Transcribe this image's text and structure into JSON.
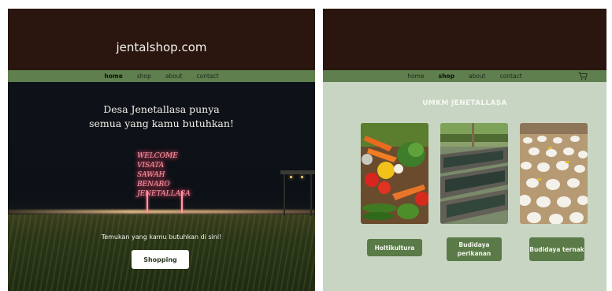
{
  "left_page": {
    "site_title": "jentalshop.com",
    "nav": [
      {
        "label": "home",
        "active": true
      },
      {
        "label": "shop",
        "active": false
      },
      {
        "label": "about",
        "active": false
      },
      {
        "label": "contact",
        "active": false
      }
    ],
    "hero": {
      "heading_line1": "Desa Jenetallasa punya",
      "heading_line2": "semua yang kamu butuhkan!",
      "neon_sign": [
        "WELCOME VISATA",
        "SAWAH BENARO",
        "JENETALLASA"
      ],
      "cta_text": "Temukan yang kamu butuhkan di sini!",
      "cta_button": "Shopping"
    }
  },
  "right_page": {
    "nav": [
      {
        "label": "home",
        "active": false
      },
      {
        "label": "shop",
        "active": true
      },
      {
        "label": "about",
        "active": false
      },
      {
        "label": "contact",
        "active": false
      }
    ],
    "cart_icon": "shopping-cart-icon",
    "heading": "UMKM JENETALLASA",
    "categories": [
      {
        "label": "Holtikultura",
        "image": "vegetables-photo"
      },
      {
        "label": "Budidaya perikanan",
        "image": "fish-ponds-photo"
      },
      {
        "label": "Budidaya ternak",
        "image": "poultry-farm-photo"
      }
    ]
  },
  "colors": {
    "header_dark": "#2a160e",
    "nav_green": "#5f7f4e",
    "button_green": "#5a7a47",
    "right_background": "#c8d5c2"
  }
}
